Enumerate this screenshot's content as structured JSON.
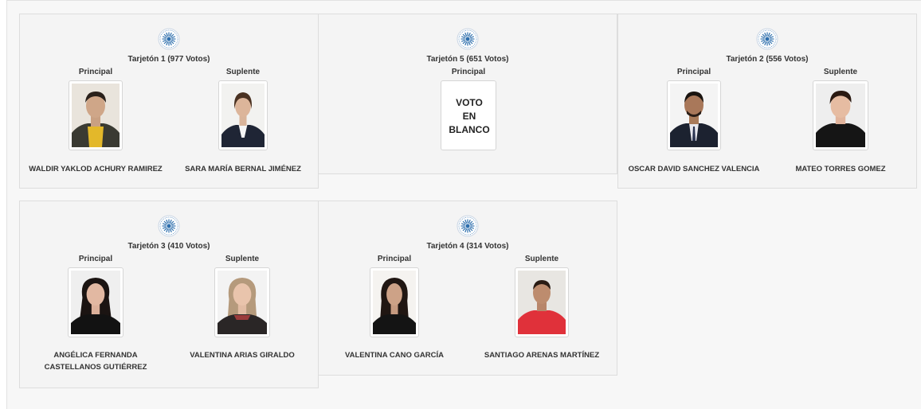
{
  "colors": {
    "background": "#f7f7f7",
    "card": "#f4f4f4",
    "card_border": "#dddddd",
    "logo": "#2e6fad"
  },
  "icons": {
    "logo": "university-seal-icon"
  },
  "cards": [
    {
      "title": "Tarjetón 1 (977 Votos)",
      "principal": {
        "role": "Principal",
        "name": "WALDIR YAKLOD ACHURY RAMIREZ"
      },
      "suplente": {
        "role": "Suplente",
        "name": "SARA MARÍA BERNAL JIMÉNEZ"
      }
    },
    {
      "title": "Tarjetón 5 (651 Votos)",
      "principal": {
        "role": "Principal",
        "name": "VOTO\nEN\nBLANCO"
      }
    },
    {
      "title": "Tarjetón 2 (556 Votos)",
      "principal": {
        "role": "Principal",
        "name": "OSCAR DAVID SANCHEZ VALENCIA"
      },
      "suplente": {
        "role": "Suplente",
        "name": "MATEO TORRES GOMEZ"
      }
    },
    {
      "title": "Tarjetón 3 (410 Votos)",
      "principal": {
        "role": "Principal",
        "name": "ANGÉLICA FERNANDA CASTELLANOS GUTIÉRREZ"
      },
      "suplente": {
        "role": "Suplente",
        "name": "VALENTINA ARIAS GIRALDO"
      }
    },
    {
      "title": "Tarjetón 4 (314 Votos)",
      "principal": {
        "role": "Principal",
        "name": "VALENTINA CANO GARCÍA"
      },
      "suplente": {
        "role": "Suplente",
        "name": "SANTIAGO ARENAS MARTÍNEZ"
      }
    }
  ]
}
